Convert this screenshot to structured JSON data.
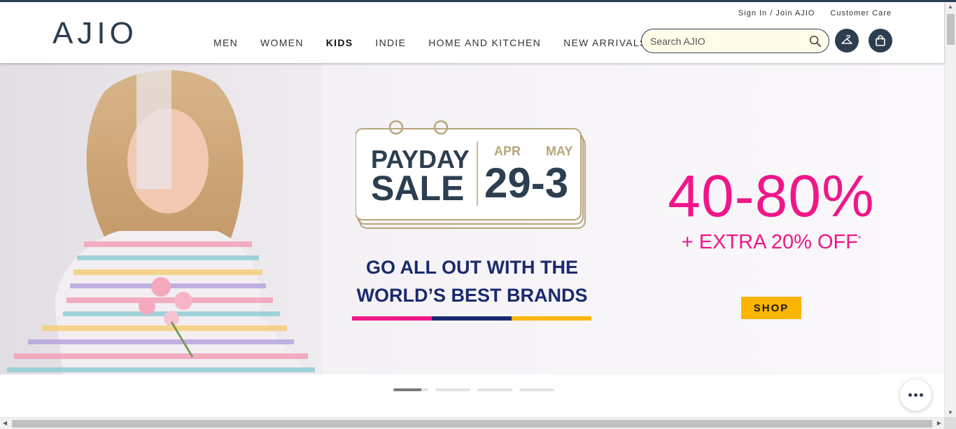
{
  "header": {
    "logo": "AJIO",
    "utility": {
      "sign_in": "Sign In / Join AJIO",
      "customer_care": "Customer Care"
    },
    "nav": [
      {
        "label": "MEN",
        "active": false
      },
      {
        "label": "WOMEN",
        "active": false
      },
      {
        "label": "KIDS",
        "active": true
      },
      {
        "label": "INDIE",
        "active": false
      },
      {
        "label": "HOME AND KITCHEN",
        "active": false
      },
      {
        "label": "NEW ARRIVALS",
        "active": false
      }
    ],
    "search": {
      "placeholder": "Search AJIO",
      "value": ""
    },
    "icons": {
      "search": "search-icon",
      "wishlist": "hanger-icon",
      "bag": "shopping-bag-icon"
    }
  },
  "banner": {
    "calendar": {
      "sale_line1": "PAYDAY",
      "sale_line2": "SALE",
      "month_start": "APR",
      "month_end": "MAY",
      "dates": "29-3"
    },
    "tagline_line1": "GO ALL OUT WITH THE",
    "tagline_line2": "WORLD’S BEST BRANDS",
    "discount": "40-80%",
    "extra": "+ EXTRA 20% OFF",
    "extra_mark": "*",
    "cta": "SHOP",
    "stripe_colors": [
      "#f0168a",
      "#1a2a6e",
      "#fbb400"
    ]
  },
  "carousel": {
    "slides": 4,
    "active": 1
  },
  "colors": {
    "brand": "#2c3e50",
    "accent_pink": "#f0168a",
    "accent_navy": "#1a2a6e",
    "accent_yellow": "#fbb400"
  }
}
